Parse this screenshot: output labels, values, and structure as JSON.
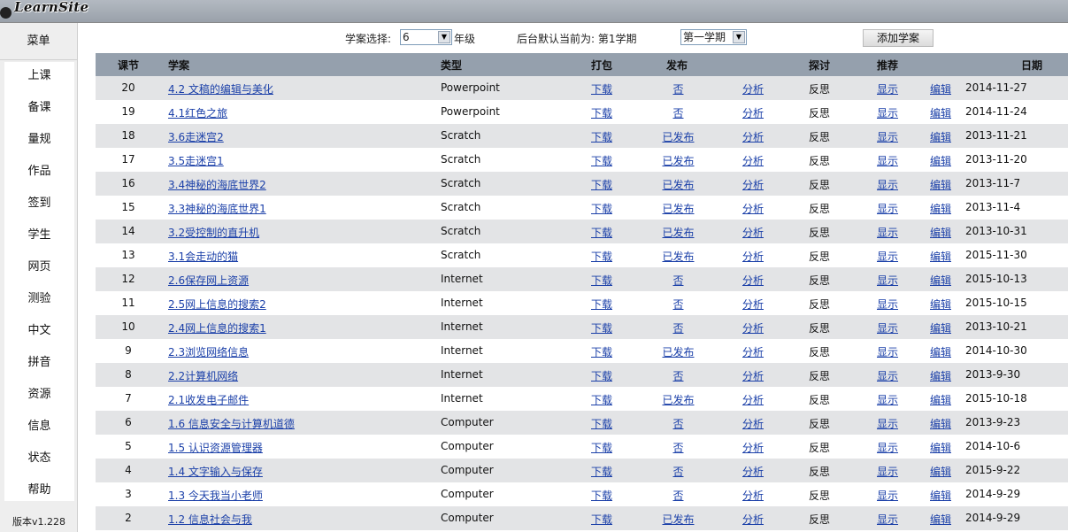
{
  "app": {
    "logo_text": "LearnSite",
    "version": "版本v1.228"
  },
  "sidebar": {
    "header": "菜单",
    "items": [
      {
        "label": "上课"
      },
      {
        "label": "备课"
      },
      {
        "label": "量规"
      },
      {
        "label": "作品"
      },
      {
        "label": "签到"
      },
      {
        "label": "学生"
      },
      {
        "label": "网页"
      },
      {
        "label": "测验"
      },
      {
        "label": "中文"
      },
      {
        "label": "拼音"
      },
      {
        "label": "资源"
      },
      {
        "label": "信息"
      },
      {
        "label": "状态"
      },
      {
        "label": "帮助"
      }
    ]
  },
  "toolbar": {
    "select_label": "学案选择:",
    "grade_value": "6",
    "grade_suffix": "年级",
    "default_label": "后台默认当前为: 第1学期",
    "term_value": "第一学期",
    "add_button": "添加学案"
  },
  "table": {
    "headers": {
      "num": "课节",
      "title": "学案",
      "type": "类型",
      "download": "打包",
      "publish": "发布",
      "discuss": "探讨",
      "recommend": "推荐",
      "date": "日期"
    },
    "rows": [
      {
        "num": "20",
        "title": "4.2 文稿的编辑与美化",
        "type": "Powerpoint",
        "dl": "下载",
        "pub": "否",
        "ana": "分析",
        "ref": "反思",
        "show": "显示",
        "edit": "编辑",
        "date": "2014-11-27"
      },
      {
        "num": "19",
        "title": "4.1红色之旅",
        "type": "Powerpoint",
        "dl": "下载",
        "pub": "否",
        "ana": "分析",
        "ref": "反思",
        "show": "显示",
        "edit": "编辑",
        "date": "2014-11-24"
      },
      {
        "num": "18",
        "title": "3.6走迷宫2",
        "type": "Scratch",
        "dl": "下载",
        "pub": "已发布",
        "ana": "分析",
        "ref": "反思",
        "show": "显示",
        "edit": "编辑",
        "date": "2013-11-21"
      },
      {
        "num": "17",
        "title": "3.5走迷宫1",
        "type": "Scratch",
        "dl": "下载",
        "pub": "已发布",
        "ana": "分析",
        "ref": "反思",
        "show": "显示",
        "edit": "编辑",
        "date": "2013-11-20"
      },
      {
        "num": "16",
        "title": "3.4神秘的海底世界2",
        "type": "Scratch",
        "dl": "下载",
        "pub": "已发布",
        "ana": "分析",
        "ref": "反思",
        "show": "显示",
        "edit": "编辑",
        "date": "2013-11-7"
      },
      {
        "num": "15",
        "title": "3.3神秘的海底世界1",
        "type": "Scratch",
        "dl": "下载",
        "pub": "已发布",
        "ana": "分析",
        "ref": "反思",
        "show": "显示",
        "edit": "编辑",
        "date": "2013-11-4"
      },
      {
        "num": "14",
        "title": "3.2受控制的直升机",
        "type": "Scratch",
        "dl": "下载",
        "pub": "已发布",
        "ana": "分析",
        "ref": "反思",
        "show": "显示",
        "edit": "编辑",
        "date": "2013-10-31"
      },
      {
        "num": "13",
        "title": "3.1会走动的猫",
        "type": "Scratch",
        "dl": "下载",
        "pub": "已发布",
        "ana": "分析",
        "ref": "反思",
        "show": "显示",
        "edit": "编辑",
        "date": "2015-11-30"
      },
      {
        "num": "12",
        "title": "2.6保存网上资源",
        "type": "Internet",
        "dl": "下载",
        "pub": "否",
        "ana": "分析",
        "ref": "反思",
        "show": "显示",
        "edit": "编辑",
        "date": "2015-10-13"
      },
      {
        "num": "11",
        "title": "2.5网上信息的搜索2",
        "type": "Internet",
        "dl": "下载",
        "pub": "否",
        "ana": "分析",
        "ref": "反思",
        "show": "显示",
        "edit": "编辑",
        "date": "2015-10-15"
      },
      {
        "num": "10",
        "title": "2.4网上信息的搜索1",
        "type": "Internet",
        "dl": "下载",
        "pub": "否",
        "ana": "分析",
        "ref": "反思",
        "show": "显示",
        "edit": "编辑",
        "date": "2013-10-21"
      },
      {
        "num": "9",
        "title": "2.3浏览网络信息",
        "type": "Internet",
        "dl": "下载",
        "pub": "已发布",
        "ana": "分析",
        "ref": "反思",
        "show": "显示",
        "edit": "编辑",
        "date": "2014-10-30"
      },
      {
        "num": "8",
        "title": "2.2计算机网络",
        "type": "Internet",
        "dl": "下载",
        "pub": "否",
        "ana": "分析",
        "ref": "反思",
        "show": "显示",
        "edit": "编辑",
        "date": "2013-9-30"
      },
      {
        "num": "7",
        "title": "2.1收发电子邮件",
        "type": "Internet",
        "dl": "下载",
        "pub": "已发布",
        "ana": "分析",
        "ref": "反思",
        "show": "显示",
        "edit": "编辑",
        "date": "2015-10-18"
      },
      {
        "num": "6",
        "title": "1.6 信息安全与计算机道德",
        "type": "Computer",
        "dl": "下载",
        "pub": "否",
        "ana": "分析",
        "ref": "反思",
        "show": "显示",
        "edit": "编辑",
        "date": "2013-9-23"
      },
      {
        "num": "5",
        "title": "1.5 认识资源管理器",
        "type": "Computer",
        "dl": "下载",
        "pub": "否",
        "ana": "分析",
        "ref": "反思",
        "show": "显示",
        "edit": "编辑",
        "date": "2014-10-6"
      },
      {
        "num": "4",
        "title": "1.4 文字输入与保存",
        "type": "Computer",
        "dl": "下载",
        "pub": "否",
        "ana": "分析",
        "ref": "反思",
        "show": "显示",
        "edit": "编辑",
        "date": "2015-9-22"
      },
      {
        "num": "3",
        "title": "1.3 今天我当小老师",
        "type": "Computer",
        "dl": "下载",
        "pub": "否",
        "ana": "分析",
        "ref": "反思",
        "show": "显示",
        "edit": "编辑",
        "date": "2014-9-29"
      },
      {
        "num": "2",
        "title": "1.2 信息社会与我",
        "type": "Computer",
        "dl": "下载",
        "pub": "已发布",
        "ana": "分析",
        "ref": "反思",
        "show": "显示",
        "edit": "编辑",
        "date": "2014-9-29"
      }
    ]
  }
}
